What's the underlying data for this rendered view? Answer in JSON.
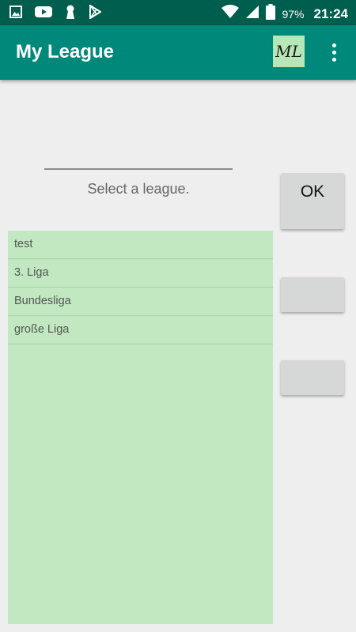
{
  "status_bar": {
    "battery_percent": "97%",
    "time": "21:24",
    "icons": [
      "gallery-icon",
      "youtube-icon",
      "keyhole-icon",
      "play-store-icon",
      "wifi-icon",
      "signal-icon",
      "battery-icon"
    ]
  },
  "app_bar": {
    "title": "My League",
    "logo_text": "ML",
    "color": "#00897b"
  },
  "form": {
    "hint": "Select a league."
  },
  "buttons": {
    "ok_label": "OK",
    "second_label": "",
    "third_label": ""
  },
  "leagues": {
    "items": [
      "test",
      "3. Liga",
      "Bundesliga",
      "große Liga"
    ],
    "background": "#c1e8c1"
  }
}
